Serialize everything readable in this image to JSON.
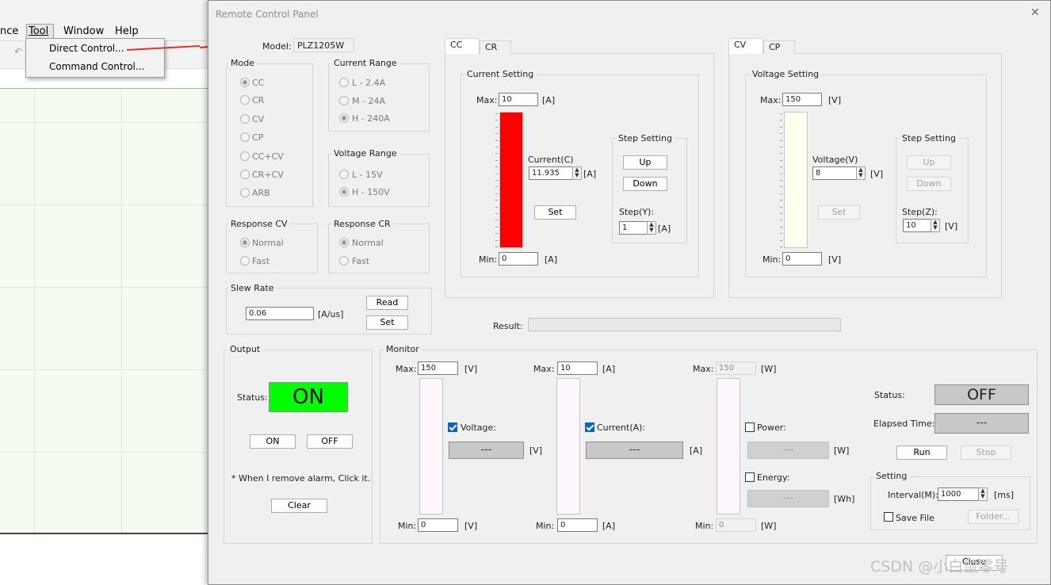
{
  "bg_app": {
    "menu": [
      "nce",
      "Tool",
      "Window",
      "Help"
    ],
    "tool_menu_items": [
      "Direct Control...",
      "Command Control..."
    ]
  },
  "window": {
    "title": "Remote Control Panel",
    "close_glyph": "✕",
    "model_label": "Model:",
    "model_value": "PLZ1205W"
  },
  "mode": {
    "title": "Mode",
    "options": [
      "CC",
      "CR",
      "CV",
      "CP",
      "CC+CV",
      "CR+CV",
      "ARB"
    ],
    "selected": "CC"
  },
  "current_range": {
    "title": "Current Range",
    "options": [
      "L - 2.4A",
      "M - 24A",
      "H - 240A"
    ],
    "selected": "H - 240A"
  },
  "voltage_range": {
    "title": "Voltage Range",
    "options": [
      "L - 15V",
      "H - 150V"
    ],
    "selected": "H - 150V"
  },
  "response_cv": {
    "title": "Response CV",
    "options": [
      "Normal",
      "Fast"
    ],
    "selected": "Normal"
  },
  "response_cr": {
    "title": "Response CR",
    "options": [
      "Normal",
      "Fast"
    ],
    "selected": "Normal"
  },
  "slew_rate": {
    "title": "Slew Rate",
    "value": "0.06",
    "unit": "[A/us]",
    "read_label": "Read",
    "set_label": "Set"
  },
  "cc_panel": {
    "tabs": [
      "CC",
      "CR"
    ],
    "group_title": "Current Setting",
    "max_label": "Max:",
    "max_value": "10",
    "max_unit": "[A]",
    "min_label": "Min:",
    "min_value": "0",
    "min_unit": "[A]",
    "param_label": "Current(C)",
    "param_value": "11.935",
    "param_unit": "[A]",
    "set_label": "Set",
    "bar_fill_fraction": 1.0,
    "bar_color": "#ff0000",
    "step": {
      "title": "Step Setting",
      "up": "Up",
      "down": "Down",
      "step_label": "Step(Y):",
      "step_value": "1",
      "step_unit": "[A]"
    }
  },
  "cv_panel": {
    "tabs": [
      "CV",
      "CP"
    ],
    "group_title": "Voltage Setting",
    "max_label": "Max:",
    "max_value": "150",
    "max_unit": "[V]",
    "min_label": "Min:",
    "min_value": "0",
    "min_unit": "[V]",
    "param_label": "Voltage(V)",
    "param_value": "8",
    "param_unit": "[V]",
    "set_label": "Set",
    "bar_color": "#fffff0",
    "step": {
      "title": "Step Setting",
      "up": "Up",
      "down": "Down",
      "step_label": "Step(Z):",
      "step_value": "10",
      "step_unit": "[V]"
    }
  },
  "result": {
    "label": "Result:",
    "value": ""
  },
  "output": {
    "title": "Output",
    "status_label": "Status:",
    "status_value": "ON",
    "status_color": "#00ff00",
    "on_label": "ON",
    "off_label": "OFF",
    "note": "* When I remove alarm, Click it.",
    "clear_label": "Clear"
  },
  "monitor": {
    "title": "Monitor",
    "voltage": {
      "max_label": "Max:",
      "max_value": "150",
      "unit": "[V]",
      "min_label": "Min:",
      "min_value": "0",
      "check_label": "Voltage:",
      "checked": true,
      "display": "---"
    },
    "current": {
      "max_label": "Max:",
      "max_value": "10",
      "unit": "[A]",
      "min_label": "Min:",
      "min_value": "0",
      "check_label": "Current(A):",
      "checked": true,
      "display": "---"
    },
    "power": {
      "max_label": "Max:",
      "max_value": "150",
      "unit": "[W]",
      "min_label": "Min:",
      "min_value": "0",
      "check_label": "Power:",
      "checked": false,
      "display": "---",
      "energy_label": "Energy:",
      "energy_checked": false,
      "energy_display": "---",
      "energy_unit": "[Wh]"
    },
    "status_label": "Status:",
    "status_value": "OFF",
    "elapsed_label": "Elapsed Time:",
    "elapsed_value": "---",
    "run_label": "Run",
    "stop_label": "Stop",
    "setting": {
      "title": "Setting",
      "interval_label": "Interval(M):",
      "interval_value": "1000",
      "interval_unit": "[ms]",
      "save_label": "Save File",
      "folder_label": "Folder..."
    }
  },
  "close_label": "Close",
  "watermark": "CSDN @小白鼠零号"
}
